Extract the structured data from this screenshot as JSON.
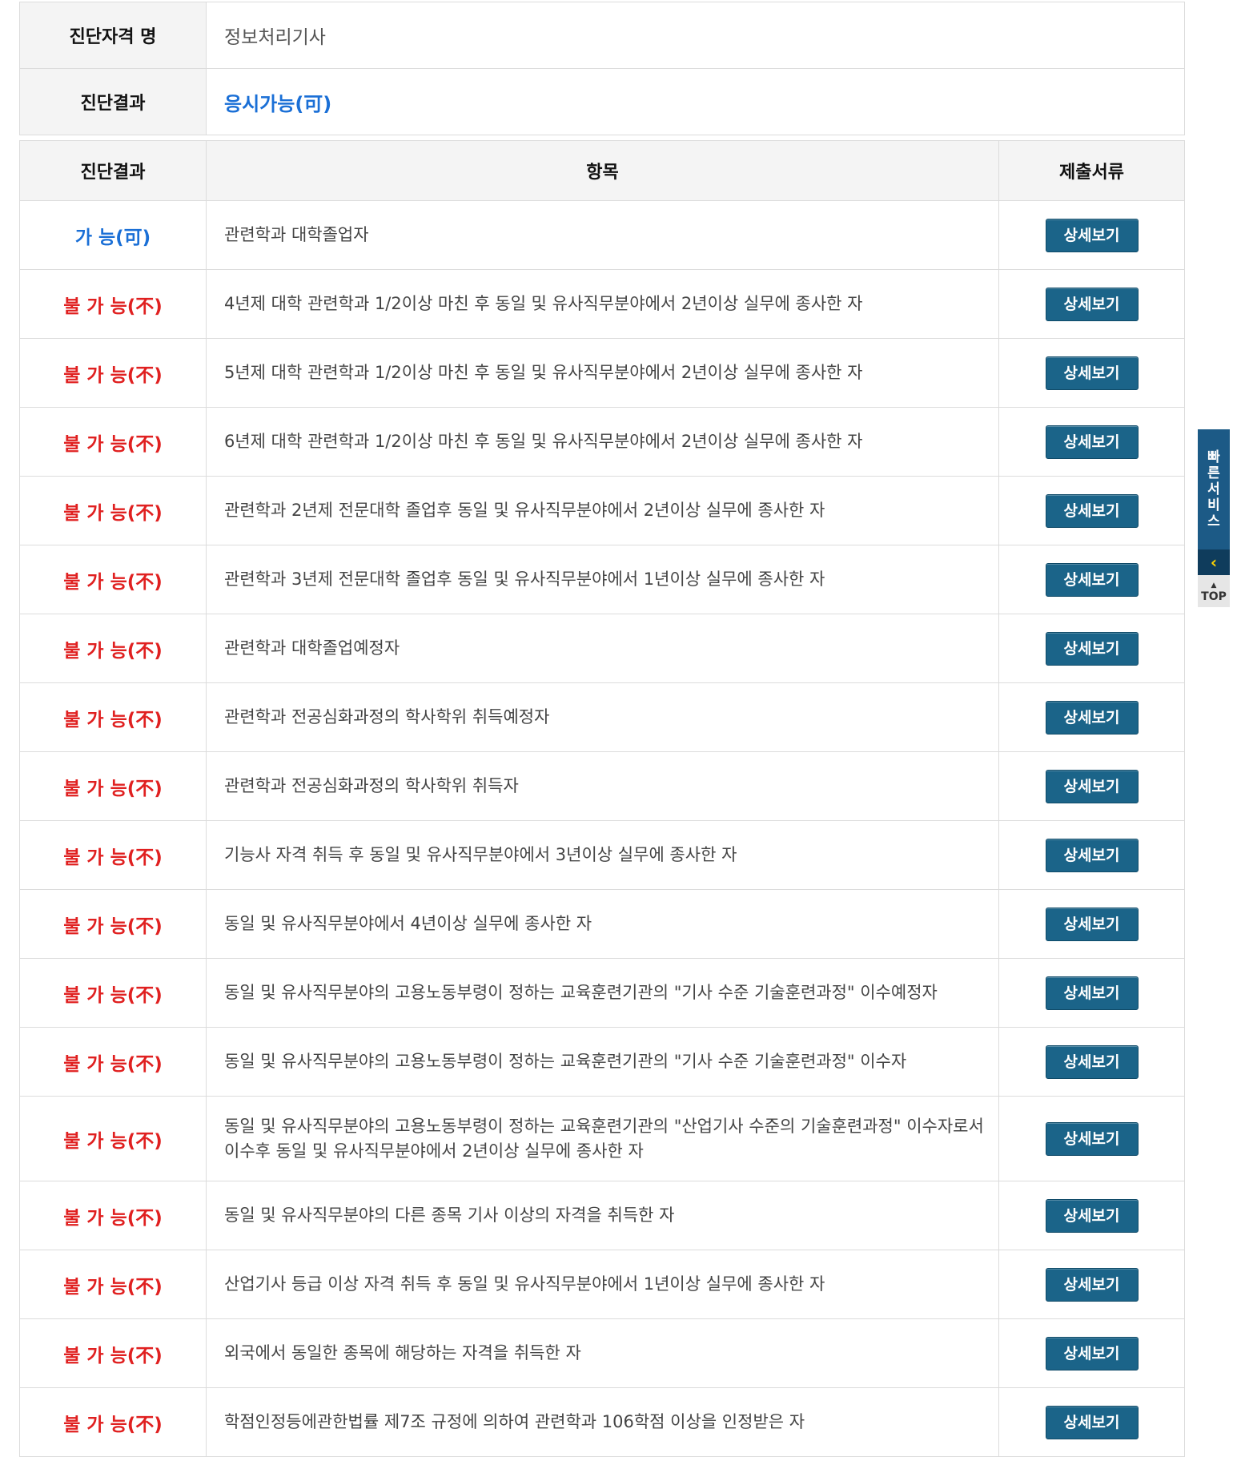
{
  "summary": {
    "qualification_label": "진단자격 명",
    "qualification_value": "정보처리기사",
    "result_label": "진단결과",
    "result_value": "응시가능(可)"
  },
  "table": {
    "headers": [
      "진단결과",
      "항목",
      "제출서류"
    ],
    "button_label": "상세보기",
    "rows": [
      {
        "status": "가 능(可)",
        "item": "관련학과 대학졸업자"
      },
      {
        "status": "불 가 능(不)",
        "item": "4년제 대학 관련학과 1/2이상 마친 후 동일 및 유사직무분야에서 2년이상 실무에 종사한 자"
      },
      {
        "status": "불 가 능(不)",
        "item": "5년제 대학 관련학과 1/2이상 마친 후 동일 및 유사직무분야에서 2년이상 실무에 종사한 자"
      },
      {
        "status": "불 가 능(不)",
        "item": "6년제 대학 관련학과 1/2이상 마친 후 동일 및 유사직무분야에서 2년이상 실무에 종사한 자"
      },
      {
        "status": "불 가 능(不)",
        "item": "관련학과 2년제 전문대학 졸업후 동일 및 유사직무분야에서 2년이상 실무에 종사한 자"
      },
      {
        "status": "불 가 능(不)",
        "item": "관련학과 3년제 전문대학 졸업후 동일 및 유사직무분야에서 1년이상 실무에 종사한 자"
      },
      {
        "status": "불 가 능(不)",
        "item": "관련학과 대학졸업예정자"
      },
      {
        "status": "불 가 능(不)",
        "item": "관련학과 전공심화과정의 학사학위 취득예정자"
      },
      {
        "status": "불 가 능(不)",
        "item": "관련학과 전공심화과정의 학사학위 취득자"
      },
      {
        "status": "불 가 능(不)",
        "item": "기능사 자격 취득 후 동일 및 유사직무분야에서 3년이상 실무에 종사한 자"
      },
      {
        "status": "불 가 능(不)",
        "item": "동일 및 유사직무분야에서 4년이상 실무에 종사한 자"
      },
      {
        "status": "불 가 능(不)",
        "item": "동일 및 유사직무분야의 고용노동부령이 정하는 교육훈련기관의 \"기사 수준 기술훈련과정\" 이수예정자"
      },
      {
        "status": "불 가 능(不)",
        "item": "동일 및 유사직무분야의 고용노동부령이 정하는 교육훈련기관의 \"기사 수준 기술훈련과정\" 이수자"
      },
      {
        "status": "불 가 능(不)",
        "item": "동일 및 유사직무분야의 고용노동부령이 정하는 교육훈련기관의 \"산업기사 수준의 기술훈련과정\" 이수자로서 이수후 동일 및 유사직무분야에서 2년이상 실무에 종사한 자"
      },
      {
        "status": "불 가 능(不)",
        "item": "동일 및 유사직무분야의 다른 종목 기사 이상의 자격을 취득한 자"
      },
      {
        "status": "불 가 능(不)",
        "item": "산업기사 등급 이상 자격 취득 후 동일 및 유사직무분야에서 1년이상 실무에 종사한 자"
      },
      {
        "status": "불 가 능(不)",
        "item": "외국에서 동일한 종목에 해당하는 자격을 취득한 자"
      },
      {
        "status": "불 가 능(不)",
        "item": "학점인정등에관한법률 제7조 규정에 의하여 관련학과 106학점 이상을 인정받은 자"
      }
    ]
  },
  "quick_menu": {
    "service_chars": [
      "빠",
      "른",
      "서",
      "비",
      "스"
    ],
    "collapse_glyph": "‹",
    "top_arrow": "▲",
    "top_label": "TOP"
  },
  "colors": {
    "possible": "#1a6fd6",
    "impossible": "#e02020",
    "button": "#1b6489"
  }
}
